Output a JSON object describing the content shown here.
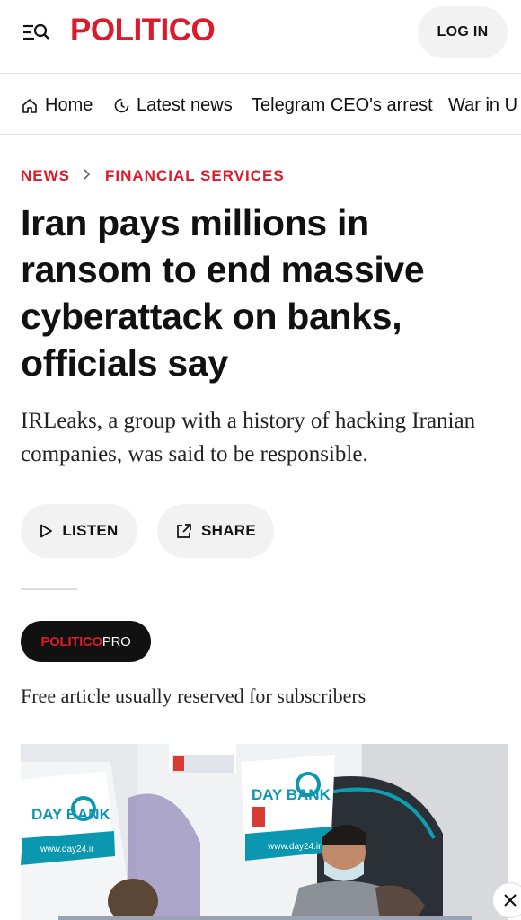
{
  "header": {
    "logo_text": "POLITICO",
    "login_label": "LOG IN",
    "brand_color": "#dc1a2b"
  },
  "nav": {
    "items": [
      {
        "label": "Home",
        "icon": "home-icon"
      },
      {
        "label": "Latest news",
        "icon": "clock-icon"
      },
      {
        "label": "Telegram CEO's arrest"
      },
      {
        "label": "War in U"
      }
    ]
  },
  "breadcrumb": {
    "section": "NEWS",
    "subsection": "FINANCIAL SERVICES"
  },
  "article": {
    "headline": "Iran pays millions in ransom to end massive cyberattack on banks, officials say",
    "dek": "IRLeaks, a group with a history of hacking Iranian companies, was said to be responsible.",
    "listen_label": "LISTEN",
    "share_label": "SHARE",
    "pro_badge_brand": "POLITICO",
    "pro_badge_suffix": "PRO",
    "free_note": "Free article usually reserved for subscribers"
  },
  "photo": {
    "sign_text_1": "DAY BANK",
    "sign_url": "www.day24.ir"
  }
}
